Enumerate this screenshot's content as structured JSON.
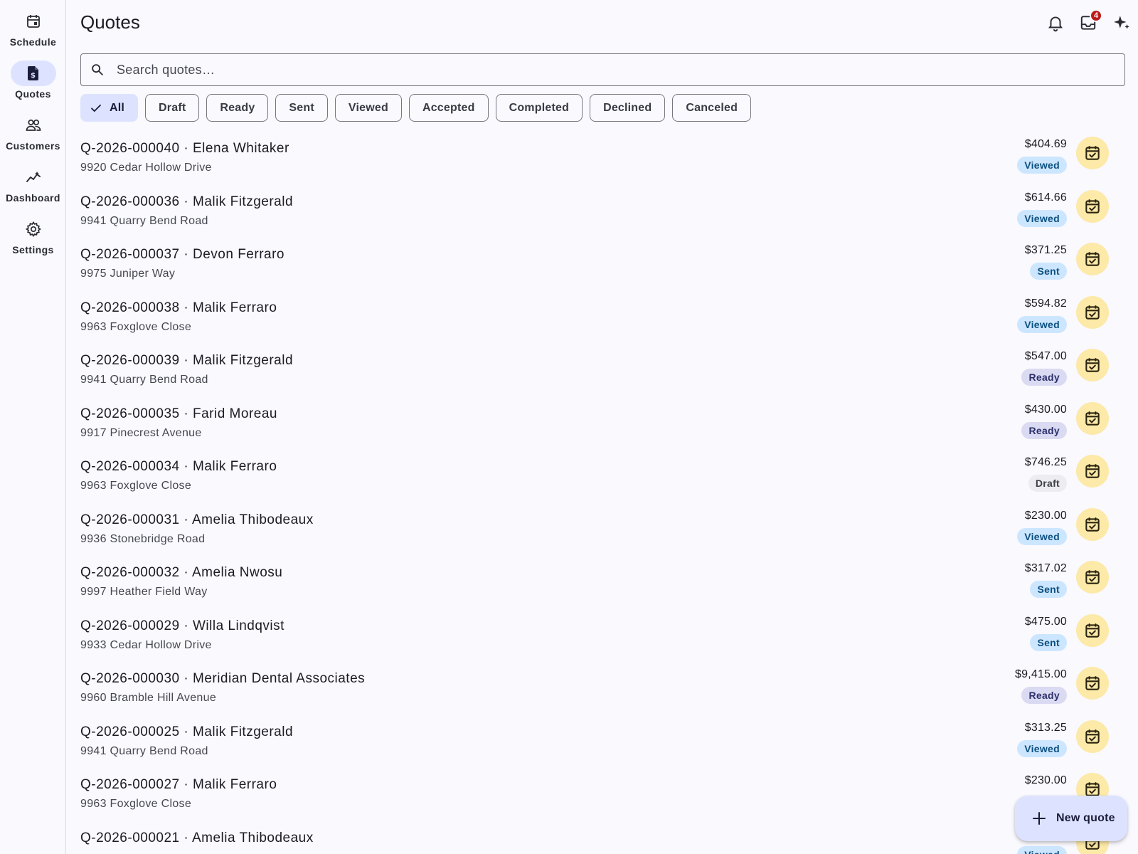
{
  "nav": {
    "items": [
      {
        "label": "Schedule",
        "icon": "calendar-icon"
      },
      {
        "label": "Quotes",
        "icon": "quote-doc-icon",
        "active": true
      },
      {
        "label": "Customers",
        "icon": "people-icon"
      },
      {
        "label": "Dashboard",
        "icon": "trend-icon"
      },
      {
        "label": "Settings",
        "icon": "gear-icon"
      }
    ]
  },
  "header": {
    "title": "Quotes",
    "inbox_badge": "4",
    "icons": [
      "bell-icon",
      "inbox-icon",
      "sparkle-icon"
    ]
  },
  "search": {
    "placeholder": "Search quotes…",
    "value": ""
  },
  "filters": {
    "selected": "All",
    "chips": [
      "All",
      "Draft",
      "Ready",
      "Sent",
      "Viewed",
      "Accepted",
      "Completed",
      "Declined",
      "Canceled"
    ]
  },
  "quotes": [
    {
      "title": "Q-2026-000040 · Elena Whitaker",
      "address": "9920 Cedar Hollow Drive",
      "amount": "$404.69",
      "status": "Viewed"
    },
    {
      "title": "Q-2026-000036 · Malik Fitzgerald",
      "address": "9941 Quarry Bend Road",
      "amount": "$614.66",
      "status": "Viewed"
    },
    {
      "title": "Q-2026-000037 · Devon Ferraro",
      "address": "9975 Juniper Way",
      "amount": "$371.25",
      "status": "Sent"
    },
    {
      "title": "Q-2026-000038 · Malik Ferraro",
      "address": "9963 Foxglove Close",
      "amount": "$594.82",
      "status": "Viewed"
    },
    {
      "title": "Q-2026-000039 · Malik Fitzgerald",
      "address": "9941 Quarry Bend Road",
      "amount": "$547.00",
      "status": "Ready"
    },
    {
      "title": "Q-2026-000035 · Farid Moreau",
      "address": "9917 Pinecrest Avenue",
      "amount": "$430.00",
      "status": "Ready"
    },
    {
      "title": "Q-2026-000034 · Malik Ferraro",
      "address": "9963 Foxglove Close",
      "amount": "$746.25",
      "status": "Draft"
    },
    {
      "title": "Q-2026-000031 · Amelia Thibodeaux",
      "address": "9936 Stonebridge Road",
      "amount": "$230.00",
      "status": "Viewed"
    },
    {
      "title": "Q-2026-000032 · Amelia Nwosu",
      "address": "9997 Heather Field Way",
      "amount": "$317.02",
      "status": "Sent"
    },
    {
      "title": "Q-2026-000029 · Willa Lindqvist",
      "address": "9933 Cedar Hollow Drive",
      "amount": "$475.00",
      "status": "Sent"
    },
    {
      "title": "Q-2026-000030 · Meridian Dental Associates",
      "address": "9960 Bramble Hill Avenue",
      "amount": "$9,415.00",
      "status": "Ready"
    },
    {
      "title": "Q-2026-000025 · Malik Fitzgerald",
      "address": "9941 Quarry Bend Road",
      "amount": "$313.25",
      "status": "Viewed"
    },
    {
      "title": "Q-2026-000027 · Malik Ferraro",
      "address": "9963 Foxglove Close",
      "amount": "$230.00",
      "status": ""
    },
    {
      "title": "Q-2026-000021 · Amelia Thibodeaux",
      "address": "",
      "amount": "",
      "status": "Viewed"
    }
  ],
  "fab": {
    "label": "New quote",
    "icon": "plus-icon"
  },
  "colors": {
    "accent": "#dde3ff",
    "action_bg": "#fde9a8",
    "badge": "#ba1a1a"
  }
}
